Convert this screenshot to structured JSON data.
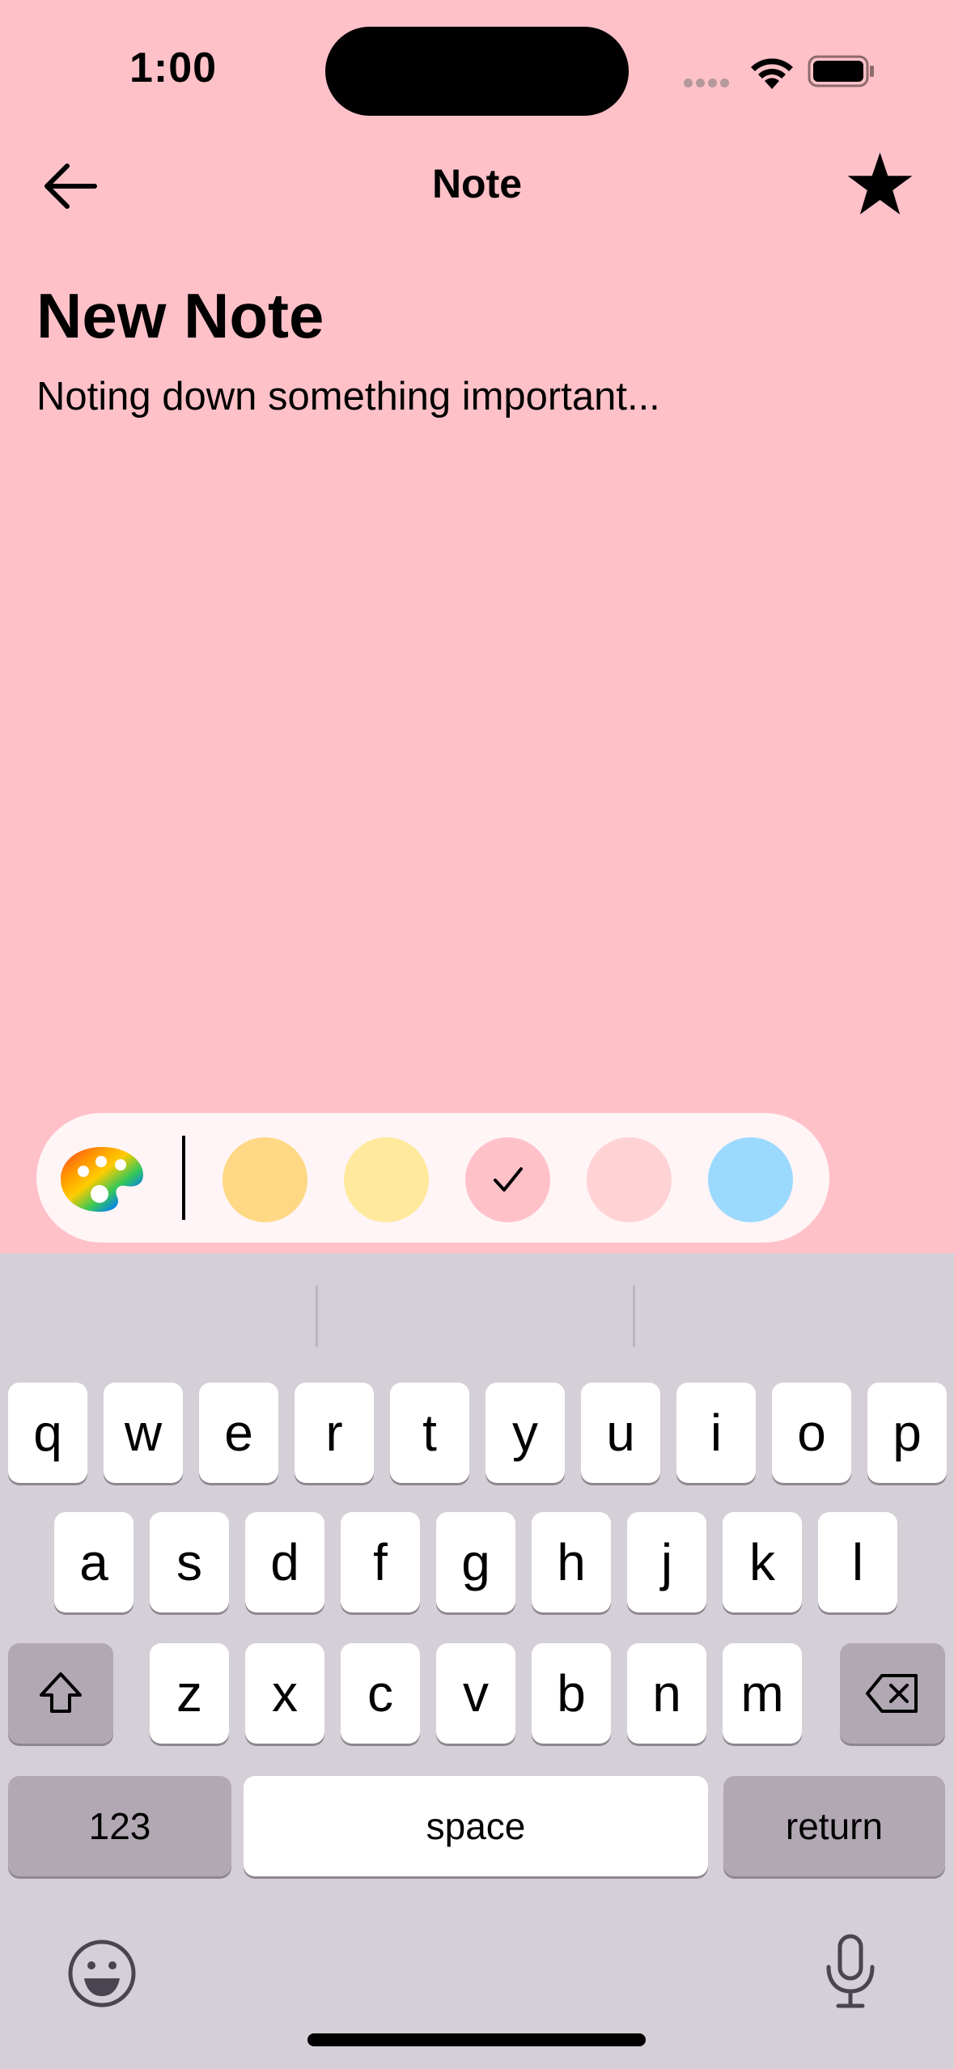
{
  "status_bar": {
    "time": "1:00"
  },
  "nav": {
    "title": "Note"
  },
  "note": {
    "title": "New Note",
    "body": "Noting down something important..."
  },
  "color_picker": {
    "swatches": [
      {
        "name": "orange",
        "color": "#ffd885",
        "selected": false
      },
      {
        "name": "yellow",
        "color": "#ffe99c",
        "selected": false
      },
      {
        "name": "pink",
        "color": "#ffc1c8",
        "selected": true
      },
      {
        "name": "light-pink",
        "color": "#ffd2d4",
        "selected": false
      },
      {
        "name": "blue",
        "color": "#9cd9fe",
        "selected": false
      }
    ]
  },
  "keyboard": {
    "row1": [
      "q",
      "w",
      "e",
      "r",
      "t",
      "y",
      "u",
      "i",
      "o",
      "p"
    ],
    "row2": [
      "a",
      "s",
      "d",
      "f",
      "g",
      "h",
      "j",
      "k",
      "l"
    ],
    "row3": [
      "z",
      "x",
      "c",
      "v",
      "b",
      "n",
      "m"
    ],
    "numbers_label": "123",
    "space_label": "space",
    "return_label": "return"
  },
  "colors": {
    "background": "#ffc1c8",
    "keyboard_bg": "#d5cfd8"
  }
}
